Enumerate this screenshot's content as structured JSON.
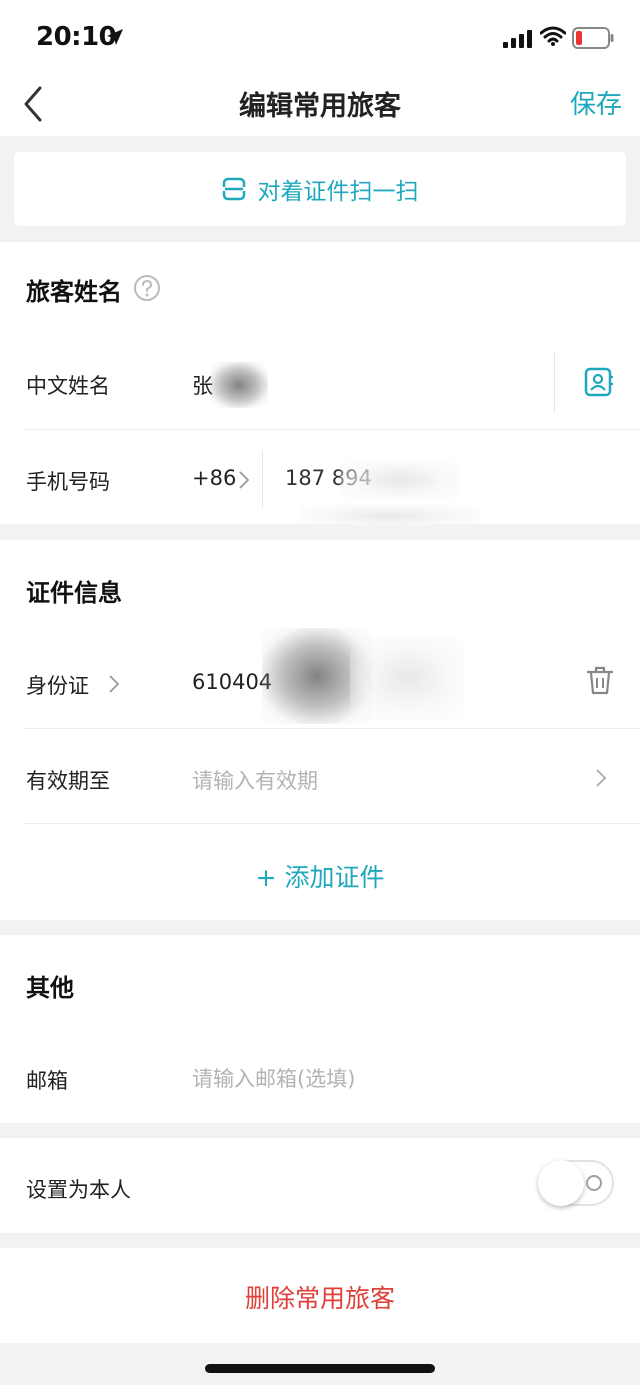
{
  "status": {
    "time": "20:10"
  },
  "nav": {
    "title": "编辑常用旅客",
    "save": "保存"
  },
  "scan": {
    "label": "对着证件扫一扫"
  },
  "name_section": {
    "title": "旅客姓名",
    "chinese_name_label": "中文姓名",
    "chinese_name_value": "张",
    "phone_label": "手机号码",
    "country_code": "+86",
    "phone_value": "187 894"
  },
  "id_section": {
    "title": "证件信息",
    "id_type": "身份证",
    "id_value": "610404",
    "expiry_label": "有效期至",
    "expiry_placeholder": "请输入有效期",
    "add_doc": "+ 添加证件"
  },
  "other_section": {
    "title": "其他",
    "email_label": "邮箱",
    "email_placeholder": "请输入邮箱(选填)"
  },
  "self_section": {
    "label": "设置为本人",
    "toggle_on": false
  },
  "delete": {
    "label": "删除常用旅客"
  },
  "colors": {
    "accent": "#1fa8bd",
    "danger": "#e0403a"
  }
}
